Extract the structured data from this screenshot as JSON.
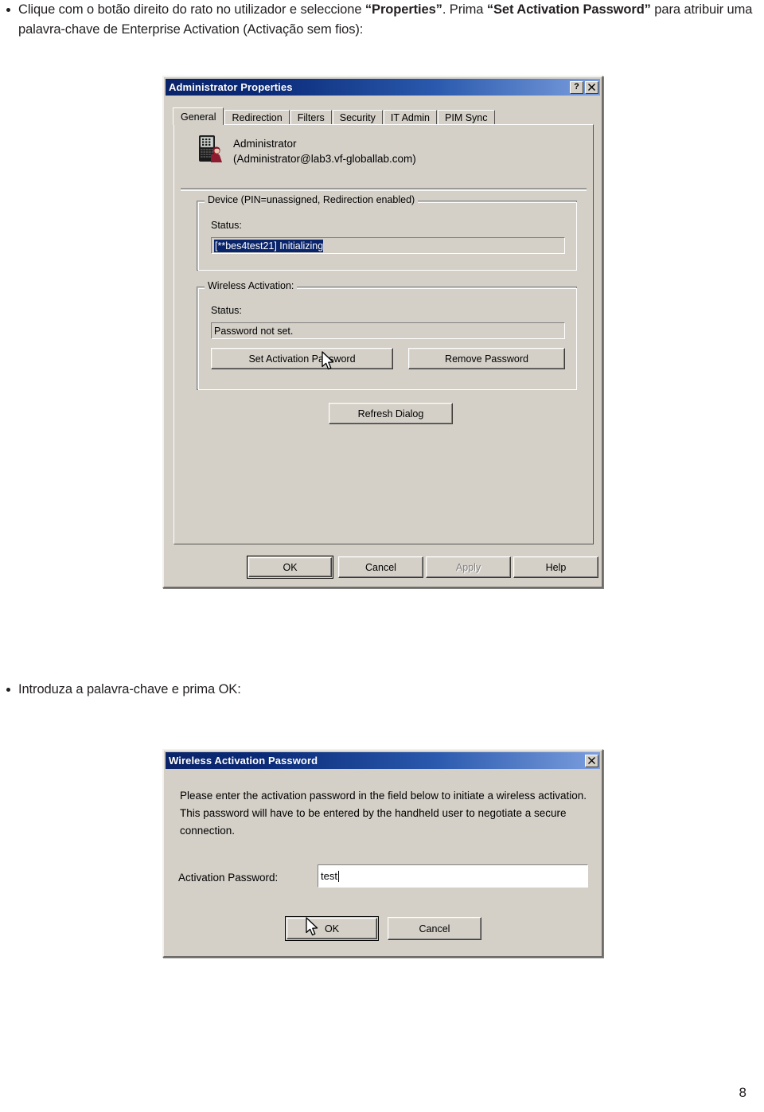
{
  "document": {
    "intro_bullet": {
      "part1": "Clique com o botão direito do rato no utilizador e seleccione ",
      "bold1": "“Properties”",
      "part2": ". Prima ",
      "bold2": "“Set Activation Password”",
      "part3": " para atribuir uma palavra-chave de Enterprise Activation (Activação sem fios):"
    },
    "second_bullet": "Introduza a palavra-chave e prima OK:",
    "page_number": "8"
  },
  "dialog_properties": {
    "title": "Administrator Properties",
    "caption_buttons": {
      "help": "?",
      "close": "✕"
    },
    "tabs": [
      {
        "label": "General",
        "active": true
      },
      {
        "label": "Redirection",
        "active": false
      },
      {
        "label": "Filters",
        "active": false
      },
      {
        "label": "Security",
        "active": false
      },
      {
        "label": "IT Admin",
        "active": false
      },
      {
        "label": "PIM Sync",
        "active": false
      }
    ],
    "user": {
      "name": "Administrator",
      "email": "(Administrator@lab3.vf-globallab.com)"
    },
    "device_group": {
      "title": "Device (PIN=unassigned, Redirection enabled)",
      "status_label": "Status:",
      "status_value": "[**bes4test21] Initializing",
      "status_selected": true
    },
    "wireless_group": {
      "title": "Wireless Activation:",
      "status_label": "Status:",
      "status_value": "Password not set.",
      "set_button": "Set Activation Password",
      "remove_button": "Remove Password"
    },
    "refresh_button": "Refresh Dialog",
    "footer_buttons": [
      {
        "label": "OK",
        "state": "default"
      },
      {
        "label": "Cancel",
        "state": "normal"
      },
      {
        "label": "Apply",
        "state": "disabled"
      },
      {
        "label": "Help",
        "state": "normal"
      }
    ]
  },
  "dialog_password": {
    "title": "Wireless Activation Password",
    "caption_buttons": {
      "close": "✕"
    },
    "message": "Please enter the activation password in the field below to initiate a wireless activation. This password will have to be entered by the handheld user to negotiate a secure connection.",
    "field_label": "Activation Password:",
    "field_value": "test",
    "buttons": [
      {
        "label": "OK",
        "state": "default"
      },
      {
        "label": "Cancel",
        "state": "normal"
      }
    ]
  },
  "colors": {
    "dialog_face": "#d4d0c8",
    "titlebar_start": "#0a246a",
    "titlebar_end": "#7b9ede",
    "selection": "#0a246a",
    "text": "#000000",
    "disabled_text": "#808080"
  }
}
